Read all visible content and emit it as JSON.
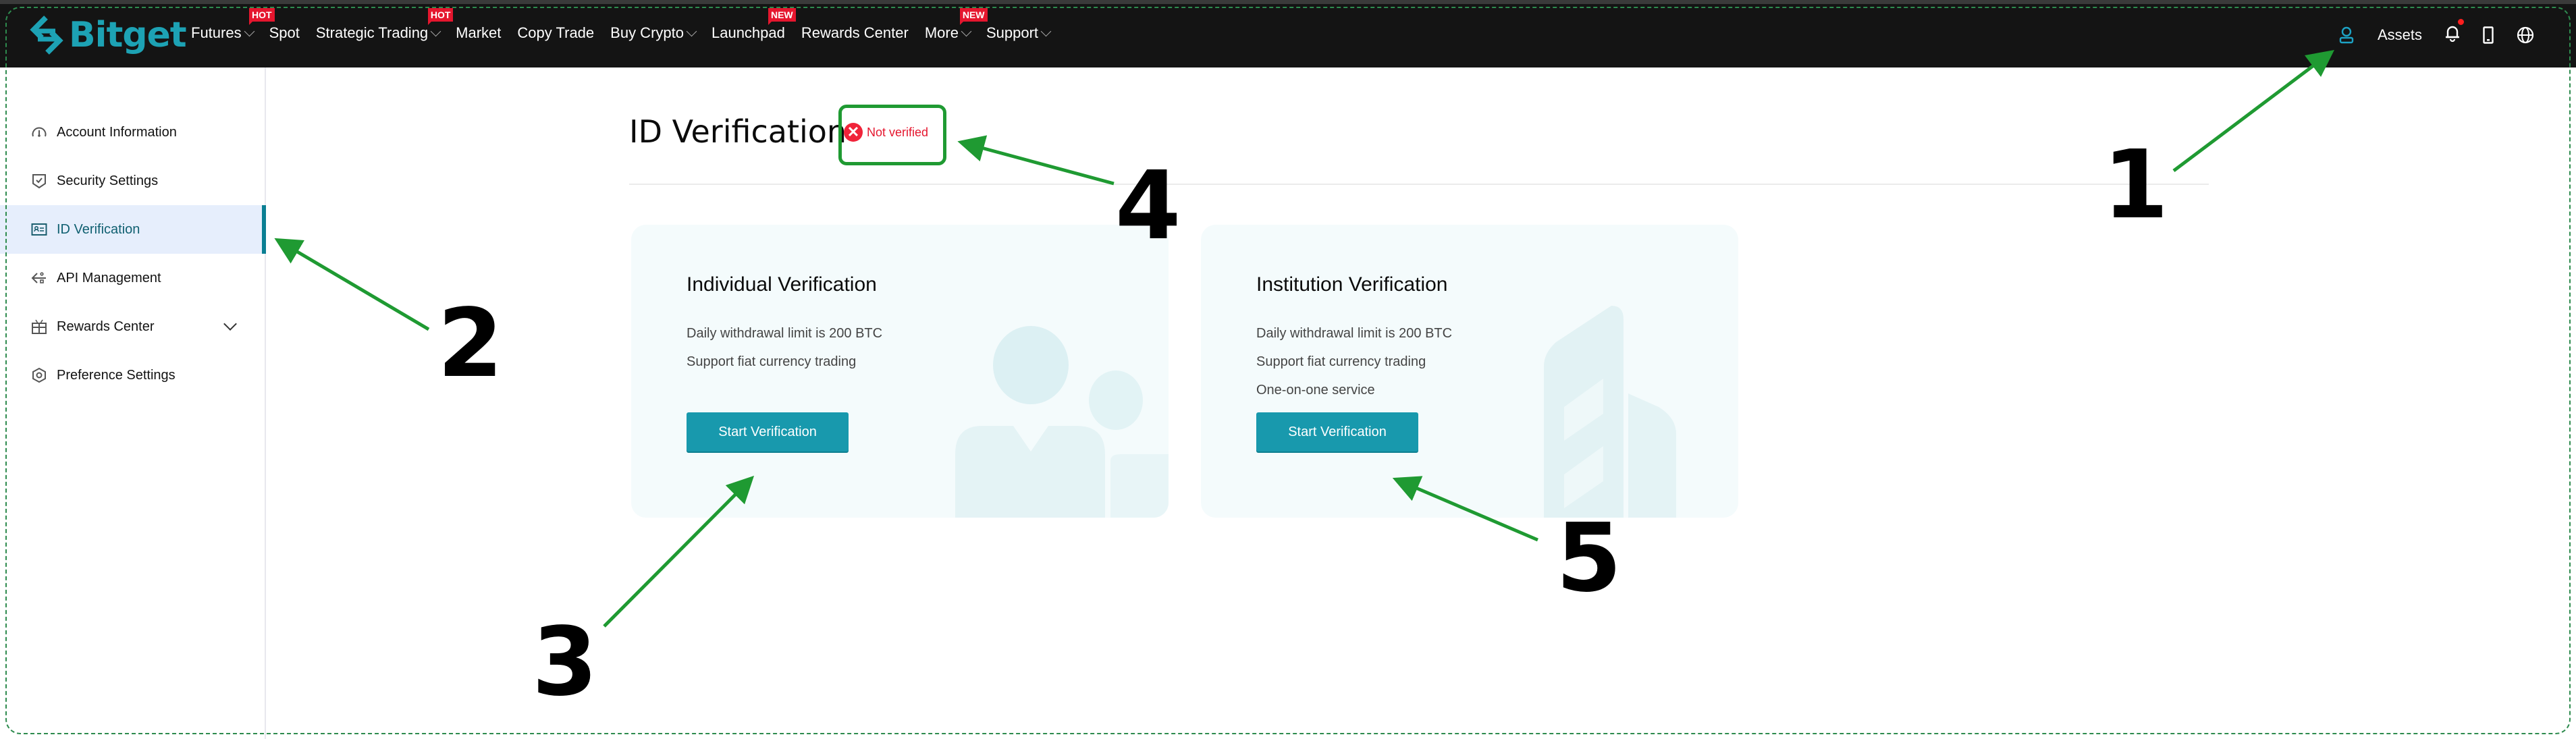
{
  "header": {
    "brand": "Bitget",
    "brand_color": "#1da2b4",
    "nav": [
      {
        "label": "Futures",
        "dropdown": true,
        "tag": "HOT"
      },
      {
        "label": "Spot",
        "dropdown": false,
        "tag": null
      },
      {
        "label": "Strategic Trading",
        "dropdown": true,
        "tag": "HOT"
      },
      {
        "label": "Market",
        "dropdown": false,
        "tag": null
      },
      {
        "label": "Copy Trade",
        "dropdown": false,
        "tag": null
      },
      {
        "label": "Buy Crypto",
        "dropdown": true,
        "tag": null
      },
      {
        "label": "Launchpad",
        "dropdown": false,
        "tag": "NEW"
      },
      {
        "label": "Rewards Center",
        "dropdown": false,
        "tag": null
      },
      {
        "label": "More",
        "dropdown": true,
        "tag": "NEW"
      },
      {
        "label": "Support",
        "dropdown": true,
        "tag": null
      }
    ],
    "right": {
      "profile_icon": "user-icon",
      "assets_label": "Assets",
      "notification_icon": "bell-icon",
      "notification_has_unread": true,
      "download_icon": "mobile-icon",
      "language_icon": "globe-icon"
    }
  },
  "sidebar": {
    "items": [
      {
        "label": "Account Information",
        "icon": "dashboard-icon",
        "active": false
      },
      {
        "label": "Security Settings",
        "icon": "shield-check-icon",
        "active": false
      },
      {
        "label": "ID Verification",
        "icon": "id-card-icon",
        "active": true
      },
      {
        "label": "API Management",
        "icon": "api-icon",
        "active": false
      },
      {
        "label": "Rewards Center",
        "icon": "gift-icon",
        "active": false,
        "expandable": true
      },
      {
        "label": "Preference Settings",
        "icon": "settings-hex-icon",
        "active": false
      }
    ]
  },
  "main": {
    "title": "ID Verification",
    "status": {
      "label": "Not verified",
      "icon": "x-circle-icon",
      "color": "#e5162e"
    },
    "cards": [
      {
        "title": "Individual Verification",
        "lines": [
          "Daily withdrawal limit is 200 BTC",
          "Support fiat currency trading"
        ],
        "button": "Start Verification",
        "illustration": "people-illustration"
      },
      {
        "title": "Institution Verification",
        "lines": [
          "Daily withdrawal limit is 200 BTC",
          "Support fiat currency trading",
          "One-on-one service"
        ],
        "button": "Start Verification",
        "illustration": "building-illustration"
      }
    ],
    "accent_color": "#1899ad"
  },
  "annotations": {
    "color": "#1f9a32",
    "labels": [
      "1",
      "2",
      "3",
      "4",
      "5"
    ]
  }
}
